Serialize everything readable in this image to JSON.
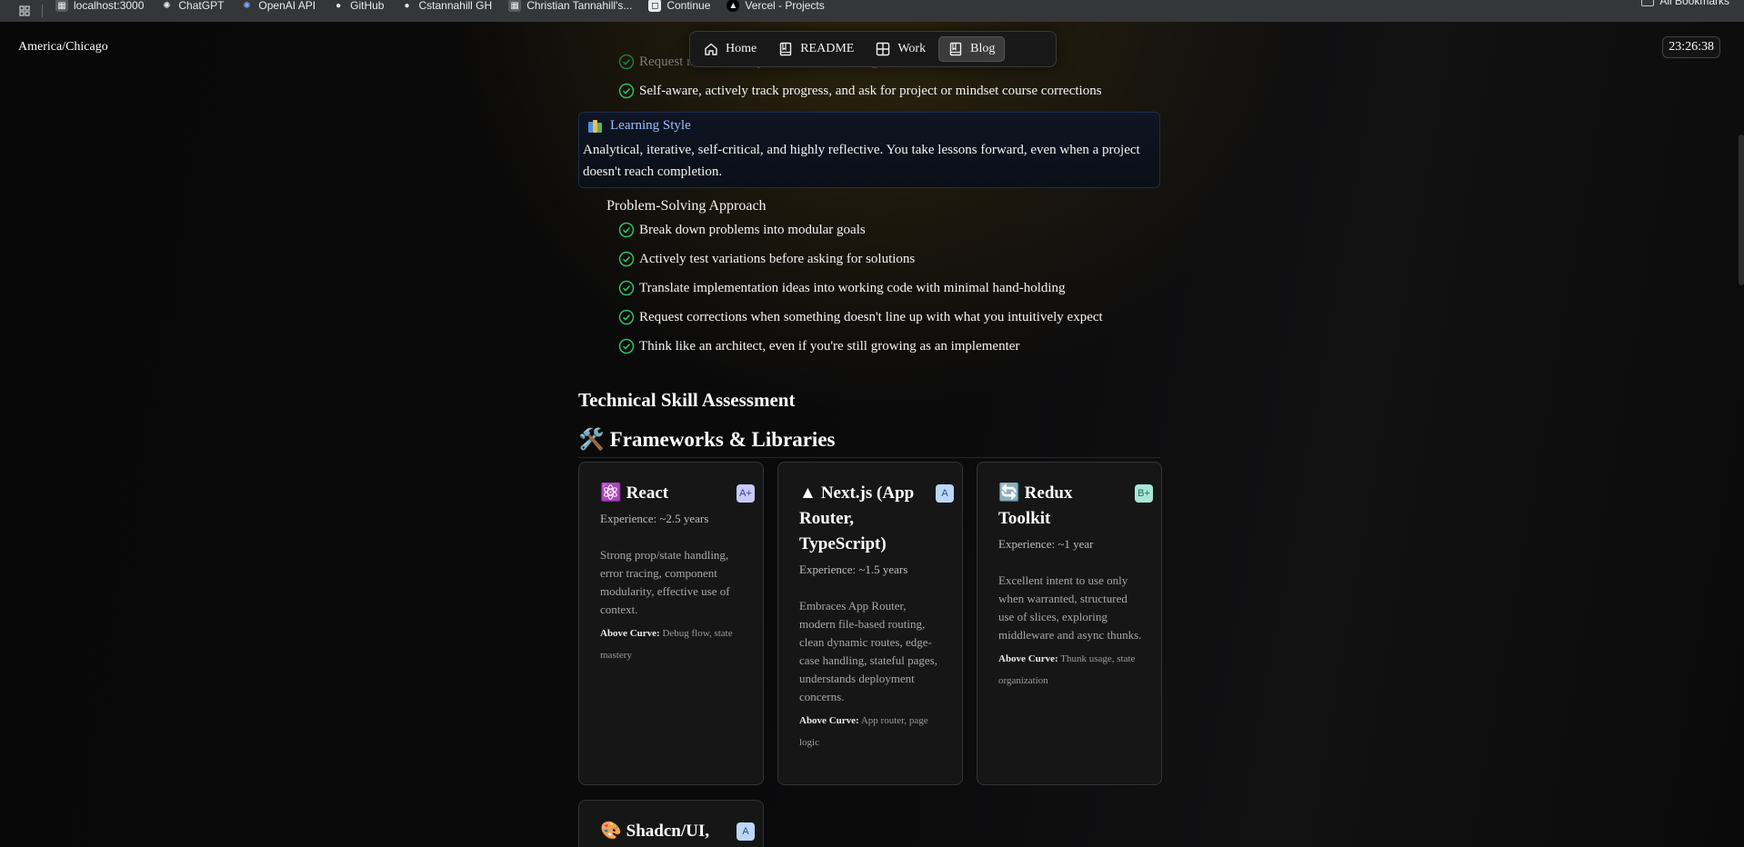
{
  "bookmarks_bar": {
    "items": [
      {
        "label": "localhost:3000",
        "icon": "localhost-icon"
      },
      {
        "label": "ChatGPT",
        "icon": "chatgpt-icon"
      },
      {
        "label": "OpenAI API",
        "icon": "openai-icon"
      },
      {
        "label": "GitHub",
        "icon": "github-icon"
      },
      {
        "label": "Cstannahill GH",
        "icon": "github-icon"
      },
      {
        "label": "Christian Tannahill's...",
        "icon": "page-icon"
      },
      {
        "label": "Continue",
        "icon": "continue-icon"
      },
      {
        "label": "Vercel - Projects",
        "icon": "vercel-icon"
      }
    ],
    "all_bookmarks": "All Bookmarks"
  },
  "header": {
    "timezone": "America/Chicago",
    "clock": "23:26:38",
    "nav": [
      {
        "label": "Home",
        "icon": "home-icon",
        "active": false
      },
      {
        "label": "README",
        "icon": "book-icon",
        "active": false
      },
      {
        "label": "Work",
        "icon": "grid-icon",
        "active": false
      },
      {
        "label": "Blog",
        "icon": "book-icon",
        "active": true
      }
    ]
  },
  "main": {
    "top_list": [
      "Request modern best practices and challenge outdated ones",
      "Self-aware, actively track progress, and ask for project or mindset course corrections"
    ],
    "learning_style": {
      "title": "Learning Style",
      "text": "Analytical, iterative, self-critical, and highly reflective. You take lessons forward, even when a project doesn't reach completion."
    },
    "problem_solving": {
      "title": "Problem-Solving Approach",
      "items": [
        "Break down problems into modular goals",
        "Actively test variations before asking for solutions",
        "Translate implementation ideas into working code with minimal hand-holding",
        "Request corrections when something doesn't line up with what you intuitively expect",
        "Think like an architect, even if you're still growing as an implementer"
      ]
    },
    "technical_heading": "Technical Skill Assessment",
    "frameworks_heading": "Frameworks & Libraries",
    "frameworks_emoji": "🛠️",
    "cards": [
      {
        "emoji": "⚛️",
        "title": "React",
        "grade": "A+",
        "experience": "Experience: ~2.5 years",
        "description": "Strong prop/state handling, error tracing, component modularity, effective use of context.",
        "above_label": "Above Curve:",
        "above_text": "Debug flow, state mastery"
      },
      {
        "emoji": "▲",
        "title": "Next.js (App Router, TypeScript)",
        "grade": "A",
        "experience": "Experience: ~1.5 years",
        "description": "Embraces App Router, modern file-based routing, clean dynamic routes, edge-case handling, stateful pages, understands deployment concerns.",
        "above_label": "Above Curve:",
        "above_text": "App router, page logic"
      },
      {
        "emoji": "🔄",
        "title": "Redux Toolkit",
        "grade": "B+",
        "experience": "Experience: ~1 year",
        "description": "Excellent intent to use only when warranted, structured use of slices, exploring middleware and async thunks.",
        "above_label": "Above Curve:",
        "above_text": "Thunk usage, state organization"
      },
      {
        "emoji": "🎨",
        "title": "Shadcn/UI,",
        "grade": "A"
      }
    ]
  }
}
